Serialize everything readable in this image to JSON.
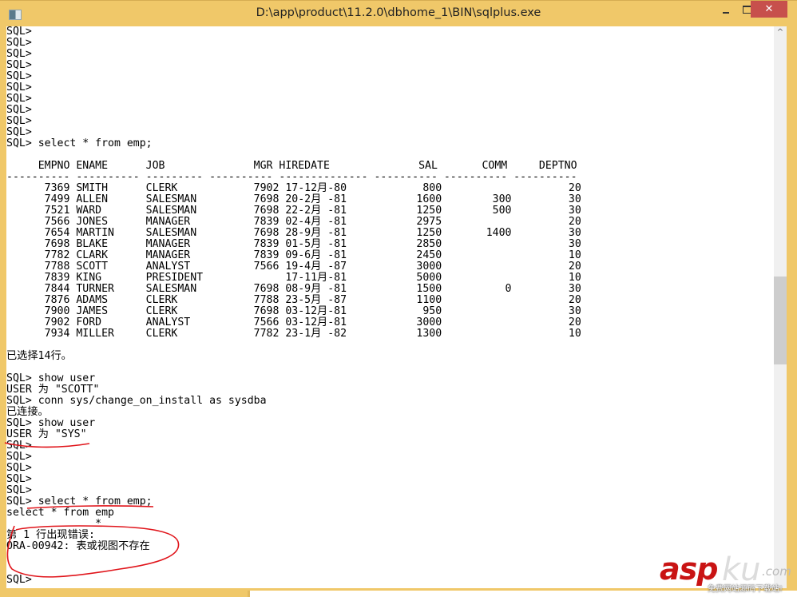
{
  "window": {
    "title": "D:\\app\\product\\11.2.0\\dbhome_1\\BIN\\sqlplus.exe",
    "controls": {
      "minimize_icon": "minimize-icon",
      "maximize_icon": "maximize-icon",
      "close_label": "✕"
    }
  },
  "console": {
    "lines": [
      "SQL>",
      "SQL>",
      "SQL>",
      "SQL>",
      "SQL>",
      "SQL>",
      "SQL>",
      "SQL>",
      "SQL>",
      "SQL>",
      "SQL> select * from emp;",
      "",
      "     EMPNO ENAME      JOB              MGR HIREDATE              SAL       COMM     DEPTNO",
      "---------- ---------- --------- ---------- -------------- ---------- ---------- ----------",
      "      7369 SMITH      CLERK            7902 17-12月-80            800                    20",
      "      7499 ALLEN      SALESMAN         7698 20-2月 -81           1600        300         30",
      "      7521 WARD       SALESMAN         7698 22-2月 -81           1250        500         30",
      "      7566 JONES      MANAGER          7839 02-4月 -81           2975                    20",
      "      7654 MARTIN     SALESMAN         7698 28-9月 -81           1250       1400         30",
      "      7698 BLAKE      MANAGER          7839 01-5月 -81           2850                    30",
      "      7782 CLARK      MANAGER          7839 09-6月 -81           2450                    10",
      "      7788 SCOTT      ANALYST          7566 19-4月 -87           3000                    20",
      "      7839 KING       PRESIDENT             17-11月-81           5000                    10",
      "      7844 TURNER     SALESMAN         7698 08-9月 -81           1500          0         30",
      "      7876 ADAMS      CLERK            7788 23-5月 -87           1100                    20",
      "      7900 JAMES      CLERK            7698 03-12月-81            950                    30",
      "      7902 FORD       ANALYST          7566 03-12月-81           3000                    20",
      "      7934 MILLER     CLERK            7782 23-1月 -82           1300                    10",
      "",
      "已选择14行。",
      "",
      "SQL> show user",
      "USER 为 \"SCOTT\"",
      "SQL> conn sys/change_on_install as sysdba",
      "已连接。",
      "SQL> show user",
      "USER 为 \"SYS\"",
      "SQL>",
      "SQL>",
      "SQL>",
      "SQL>",
      "SQL>",
      "SQL> select * from emp;",
      "select * from emp",
      "              *",
      "第 1 行出现错误:",
      "ORA-00942: 表或视图不存在",
      "",
      "",
      "SQL>"
    ]
  },
  "query_result": {
    "columns": [
      "EMPNO",
      "ENAME",
      "JOB",
      "MGR",
      "HIREDATE",
      "SAL",
      "COMM",
      "DEPTNO"
    ],
    "rows": [
      [
        "7369",
        "SMITH",
        "CLERK",
        "7902",
        "17-12月-80",
        "800",
        "",
        "20"
      ],
      [
        "7499",
        "ALLEN",
        "SALESMAN",
        "7698",
        "20-2月 -81",
        "1600",
        "300",
        "30"
      ],
      [
        "7521",
        "WARD",
        "SALESMAN",
        "7698",
        "22-2月 -81",
        "1250",
        "500",
        "30"
      ],
      [
        "7566",
        "JONES",
        "MANAGER",
        "7839",
        "02-4月 -81",
        "2975",
        "",
        "20"
      ],
      [
        "7654",
        "MARTIN",
        "SALESMAN",
        "7698",
        "28-9月 -81",
        "1250",
        "1400",
        "30"
      ],
      [
        "7698",
        "BLAKE",
        "MANAGER",
        "7839",
        "01-5月 -81",
        "2850",
        "",
        "30"
      ],
      [
        "7782",
        "CLARK",
        "MANAGER",
        "7839",
        "09-6月 -81",
        "2450",
        "",
        "10"
      ],
      [
        "7788",
        "SCOTT",
        "ANALYST",
        "7566",
        "19-4月 -87",
        "3000",
        "",
        "20"
      ],
      [
        "7839",
        "KING",
        "PRESIDENT",
        "",
        "17-11月-81",
        "5000",
        "",
        "10"
      ],
      [
        "7844",
        "TURNER",
        "SALESMAN",
        "7698",
        "08-9月 -81",
        "1500",
        "0",
        "30"
      ],
      [
        "7876",
        "ADAMS",
        "CLERK",
        "7788",
        "23-5月 -87",
        "1100",
        "",
        "20"
      ],
      [
        "7900",
        "JAMES",
        "CLERK",
        "7698",
        "03-12月-81",
        "950",
        "",
        "30"
      ],
      [
        "7902",
        "FORD",
        "ANALYST",
        "7566",
        "03-12月-81",
        "3000",
        "",
        "20"
      ],
      [
        "7934",
        "MILLER",
        "CLERK",
        "7782",
        "23-1月 -82",
        "1300",
        "",
        "10"
      ]
    ],
    "row_count_message": "已选择14行。"
  },
  "annotations": {
    "color": "#e0141a",
    "items": [
      "underline-user-sys",
      "underline-select-query",
      "circle-error-message"
    ]
  },
  "scrollbar": {
    "up_arrow": "^"
  },
  "watermark": {
    "brand_red": "asp",
    "brand_gray": "ku",
    "suffix": ".com",
    "tagline": "免费网站源码下载站!"
  }
}
